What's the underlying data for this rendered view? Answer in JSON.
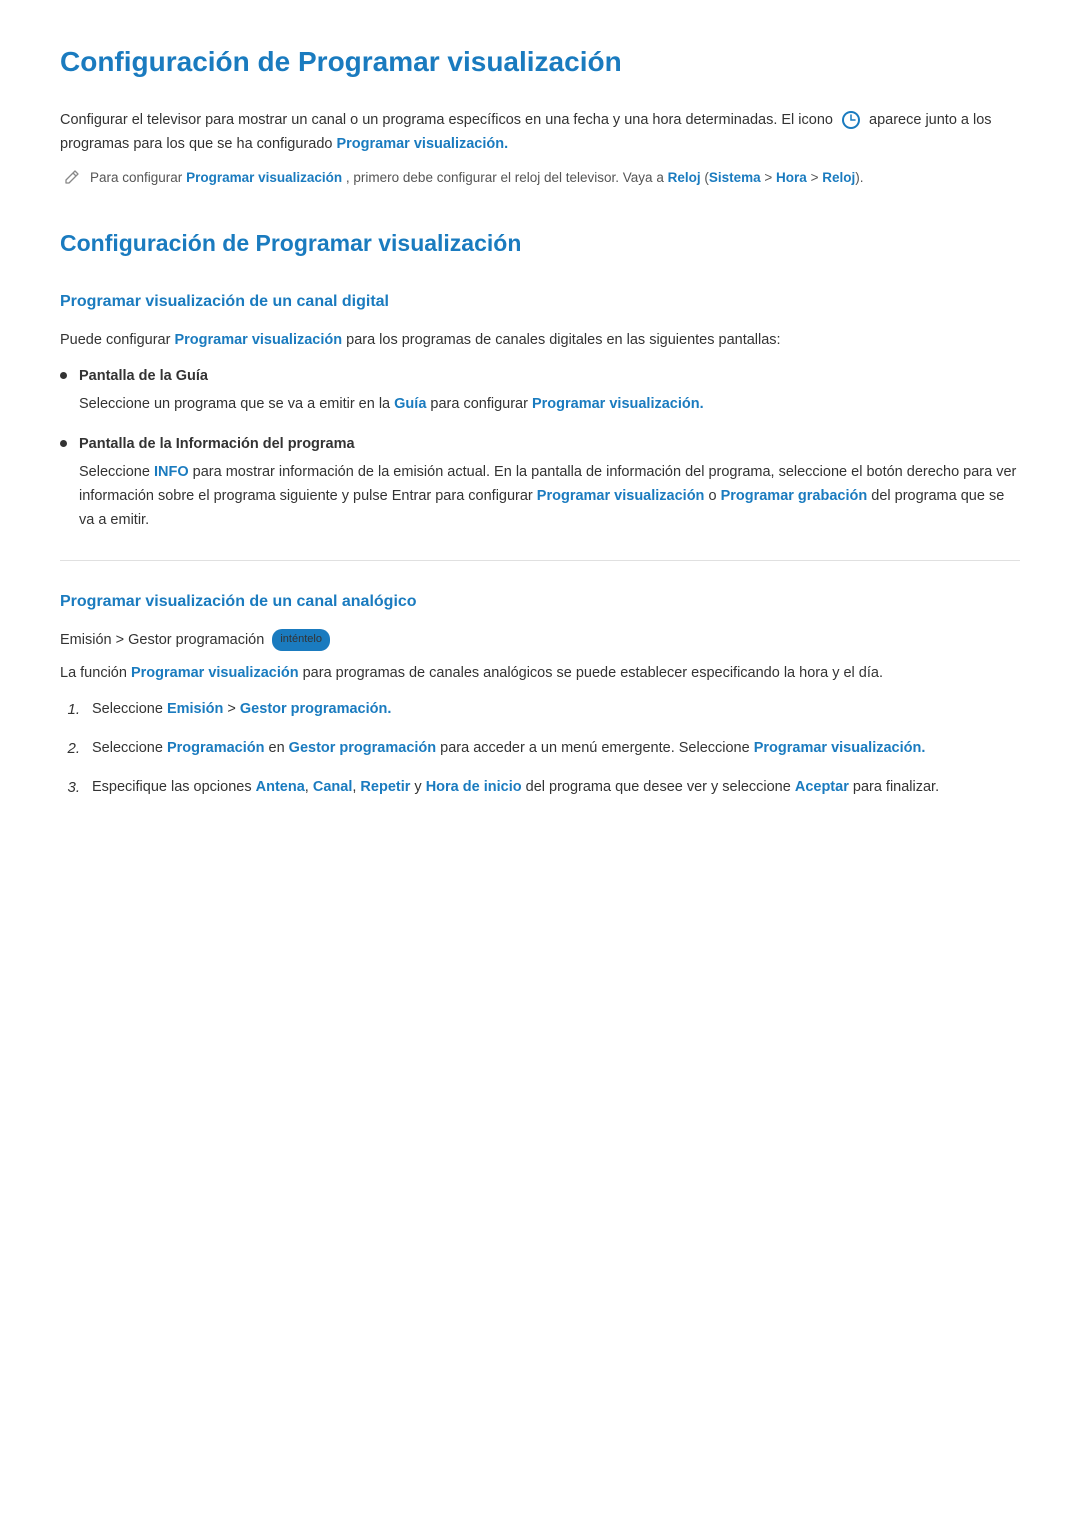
{
  "page": {
    "title": "Configuración de Programar visualización",
    "intro": "Configurar el televisor para mostrar un canal o un programa específicos en una fecha y una hora determinadas. El icono",
    "intro_after_icon": "aparece junto a los programas para los que se ha configurado",
    "intro_bold_link": "Programar visualización.",
    "note_text_pre": "Para configurar",
    "note_bold1": "Programar visualización",
    "note_text_mid": ", primero debe configurar el reloj del televisor. Vaya a",
    "note_bold2": "Reloj",
    "note_paren_open": "(",
    "note_bold3": "Sistema",
    "note_arrow1": " > ",
    "note_bold4": "Hora",
    "note_arrow2": " > ",
    "note_bold5": "Reloj",
    "note_paren_close": ")."
  },
  "section": {
    "title": "Configuración de Programar visualización",
    "subsection1": {
      "title": "Programar visualización de un canal digital",
      "intro_pre": "Puede configurar",
      "intro_bold": "Programar visualización",
      "intro_post": "para los programas de canales digitales en las siguientes pantallas:",
      "bullets": [
        {
          "title": "Pantalla de la Guía",
          "desc_pre": "Seleccione un programa que se va a emitir en la",
          "desc_bold1": "Guía",
          "desc_mid": "para configurar",
          "desc_bold2": "Programar visualización."
        },
        {
          "title": "Pantalla de la Información del programa",
          "desc_pre": "Seleccione",
          "desc_bold1": "INFO",
          "desc_mid": "para mostrar información de la emisión actual. En la pantalla de información del programa, seleccione el botón derecho para ver información sobre el programa siguiente y pulse Entrar para configurar",
          "desc_bold2": "Programar visualización",
          "desc_or": "o",
          "desc_bold3": "Programar grabación",
          "desc_post": "del programa que se va a emitir."
        }
      ]
    },
    "subsection2": {
      "title": "Programar visualización de un canal analógico",
      "path_bold1": "Emisión",
      "path_arrow": " > ",
      "path_bold2": "Gestor programación",
      "path_badge": "inténtelo",
      "intro_pre": "La función",
      "intro_bold": "Programar visualización",
      "intro_post": "para programas de canales analógicos se puede establecer especificando la hora y el día.",
      "steps": [
        {
          "num": "1.",
          "text_pre": "Seleccione",
          "text_bold1": "Emisión",
          "text_arrow": " > ",
          "text_bold2": "Gestor programación."
        },
        {
          "num": "2.",
          "text_pre": "Seleccione",
          "text_bold1": "Programación",
          "text_mid": "en",
          "text_bold2": "Gestor programación",
          "text_post": "para acceder a un menú emergente. Seleccione",
          "text_bold3": "Programar visualización."
        },
        {
          "num": "3.",
          "text_pre": "Especifique las opciones",
          "text_bold1": "Antena",
          "text_comma1": ",",
          "text_bold2": "Canal",
          "text_comma2": ",",
          "text_bold3": "Repetir",
          "text_y": "y",
          "text_bold4": "Hora de inicio",
          "text_post": "del programa que desee ver y seleccione",
          "text_bold5": "Aceptar",
          "text_end": "para finalizar."
        }
      ]
    }
  }
}
